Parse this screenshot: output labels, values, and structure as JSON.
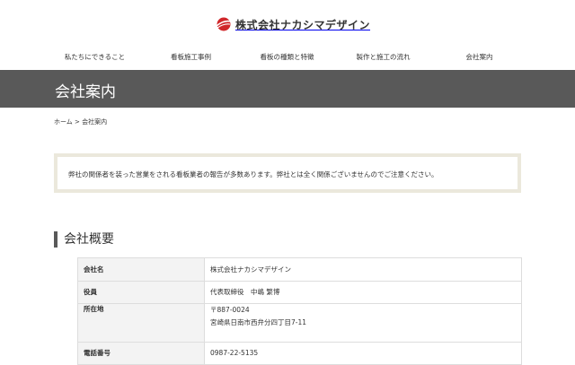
{
  "header": {
    "logo_text": "株式会社ナカシマデザイン",
    "brand_color": "#d0262a"
  },
  "nav": {
    "items": [
      {
        "label": "私たちにできること"
      },
      {
        "label": "看板施工事例"
      },
      {
        "label": "看板の種類と特徴"
      },
      {
        "label": "製作と施工の流れ"
      },
      {
        "label": "会社案内"
      }
    ]
  },
  "page": {
    "title": "会社案内",
    "band_color": "#595959"
  },
  "breadcrumb": {
    "home": "ホーム",
    "separator": ">",
    "current": "会社案内"
  },
  "notice": {
    "text": "弊社の関係者を装った営業をされる看板業者の報告が多数あります。弊社とは全く関係ございませんのでご注意ください。"
  },
  "section": {
    "heading": "会社概要"
  },
  "company_table": {
    "rows": [
      {
        "label": "会社名",
        "lines": [
          "株式会社ナカシマデザイン"
        ]
      },
      {
        "label": "役員",
        "lines": [
          "代表取締役　中嶋 繁博"
        ]
      },
      {
        "label": "所在地",
        "lines": [
          "〒887-0024",
          "宮崎県日南市西弁分四丁目7-11"
        ]
      },
      {
        "label": "電話番号",
        "lines": [
          "0987-22-5135"
        ]
      }
    ]
  }
}
